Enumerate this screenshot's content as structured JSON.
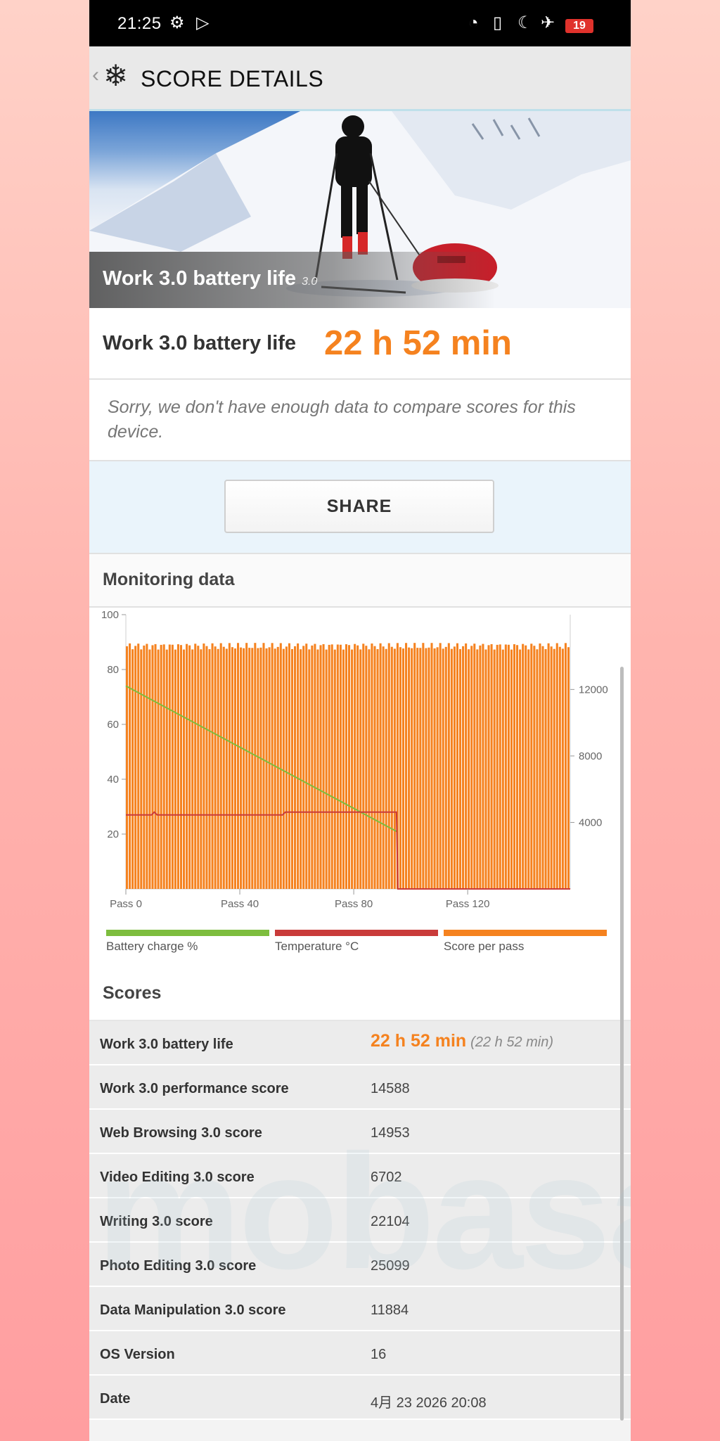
{
  "status_bar": {
    "time": "21:25",
    "battery_level": "19"
  },
  "header": {
    "title": "SCORE DETAILS"
  },
  "hero": {
    "title": "Work 3.0 battery life",
    "version": "3.0"
  },
  "result": {
    "label": "Work 3.0 battery life",
    "value": "22 h 52 min"
  },
  "compare_note": "Sorry, we don't have enough data to compare scores for this device.",
  "share_label": "SHARE",
  "monitoring": {
    "title": "Monitoring data"
  },
  "chart_data": {
    "type": "bar",
    "left_axis": {
      "ticks": [
        20,
        40,
        60,
        80,
        100
      ],
      "range": [
        0,
        100
      ]
    },
    "right_axis": {
      "ticks": [
        4000,
        8000,
        12000
      ],
      "range": [
        0,
        16500
      ]
    },
    "x_axis": {
      "ticks": [
        "Pass 0",
        "Pass 40",
        "Pass 80",
        "Pass 120"
      ],
      "range": [
        0,
        156
      ]
    },
    "series": [
      {
        "name": "Battery charge %",
        "type": "line",
        "color": "#7dbd3e",
        "x": [
          0,
          95
        ],
        "y": [
          74,
          21
        ]
      },
      {
        "name": "Temperature °C",
        "type": "line",
        "color": "#c93b3a",
        "x": [
          0,
          9,
          10,
          11,
          55,
          56,
          95,
          95.5,
          156
        ],
        "y": [
          27,
          27,
          28,
          27,
          27,
          28,
          28,
          0,
          0
        ]
      },
      {
        "name": "Score per pass",
        "type": "bar",
        "color": "#f5821f",
        "passes": 156,
        "value_range": [
          14400,
          14800
        ]
      }
    ],
    "grid": false
  },
  "legend": [
    "Battery charge %",
    "Temperature °C",
    "Score per pass"
  ],
  "scores_title": "Scores",
  "score_rows": [
    {
      "label": "Work 3.0 battery life",
      "value": "22 h 52 min",
      "sub": "(22 h 52 min)"
    },
    {
      "label": "Work 3.0 performance score",
      "value": "14588"
    },
    {
      "label": "Web Browsing 3.0 score",
      "value": "14953"
    },
    {
      "label": "Video Editing 3.0 score",
      "value": "6702"
    },
    {
      "label": "Writing 3.0 score",
      "value": "22104"
    },
    {
      "label": "Photo Editing 3.0 score",
      "value": "25099"
    },
    {
      "label": "Data Manipulation 3.0 score",
      "value": "11884"
    },
    {
      "label": "OS Version",
      "value": "16"
    },
    {
      "label": "Date",
      "value": "4月 23 2026 20:08"
    }
  ],
  "watermark": "mobasai",
  "colors": {
    "accent": "#f5821f",
    "battery": "#7dbd3e",
    "temperature": "#c93b3a"
  }
}
